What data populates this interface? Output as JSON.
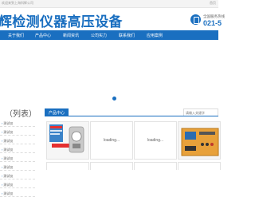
{
  "topbar": {
    "welcome": "欢迎来到上海科辉公司",
    "home_link": "首页"
  },
  "header": {
    "logo_text": "辉检测仪器高压设备",
    "hotline_label": "全国服务热线",
    "hotline_number": "021-5"
  },
  "nav": {
    "items": [
      "关于我们",
      "产品中心",
      "新闻资讯",
      "公司实力",
      "联系我们",
      "应用案例"
    ]
  },
  "banner": {
    "active_slide": 1,
    "slide_count": 2
  },
  "search": {
    "placeholder": "请输入关键字"
  },
  "sidebar": {
    "title": "（列表）",
    "items": [
      "测试仪",
      "测试仪",
      "测试仪",
      "测试仪",
      "测试仪",
      "测试仪",
      "测试仪",
      "测试仪",
      "测试仪"
    ]
  },
  "products": {
    "section_title": "产品中心",
    "items": [
      {
        "caption": "KGG-2型石英光电测厚仪",
        "loading": ""
      },
      {
        "caption": "承装承试资质配套设备",
        "loading": "loading..."
      },
      {
        "caption": "承装承试资质配套设备",
        "loading": "loading..."
      },
      {
        "caption": "全自动变比组别测试仪",
        "loading": ""
      }
    ]
  },
  "colors": {
    "brand_blue": "#1a6fc0",
    "topbar_bg": "#f4f4f4"
  }
}
